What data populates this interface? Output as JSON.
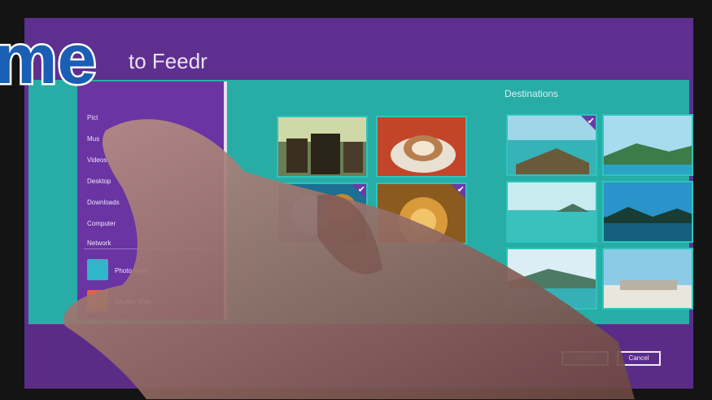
{
  "app": {
    "title": "to Feedr"
  },
  "logo": {
    "text": "me"
  },
  "destinations": {
    "label": "Destinations"
  },
  "sidebar": {
    "items": [
      {
        "label": "Pict"
      },
      {
        "label": "Mus"
      },
      {
        "label": "Videos"
      },
      {
        "label": "Desktop"
      },
      {
        "label": "Downloads"
      },
      {
        "label": "Computer"
      },
      {
        "label": "Network"
      }
    ],
    "apps": [
      {
        "label": "Photo Feed",
        "color": "#2fb6c9"
      },
      {
        "label": "Shutter Web",
        "color": "#e8603c"
      }
    ]
  },
  "buttons": {
    "import": "Import",
    "cancel": "Cancel"
  },
  "colors": {
    "screen_bg": "#5e2f8f",
    "teal": "#27ada5",
    "sidebar": "#6a34a3",
    "accent": "#6a3aa8"
  }
}
